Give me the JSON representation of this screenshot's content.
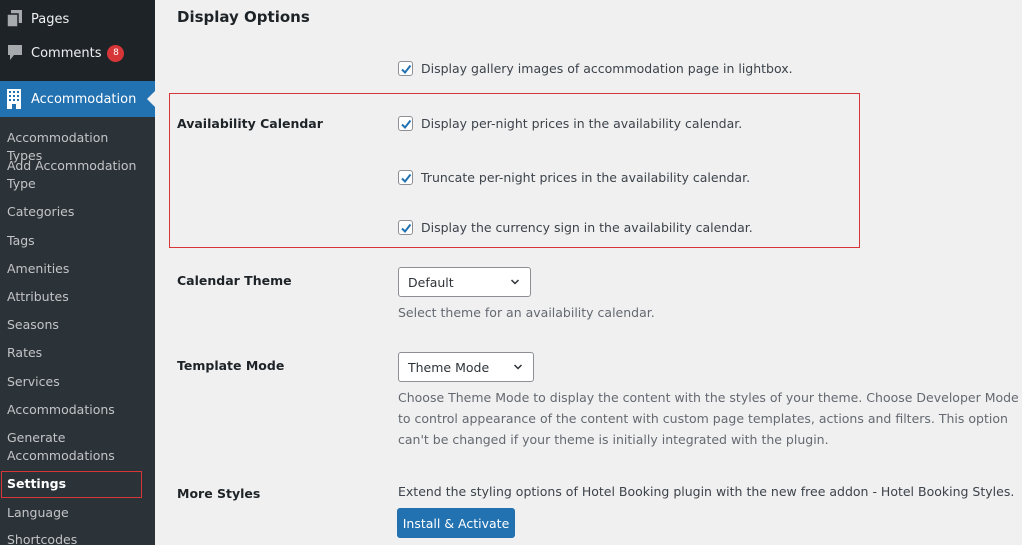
{
  "sidebar": {
    "top_items": [
      {
        "label": "Pages",
        "icon": "pages-icon"
      },
      {
        "label": "Comments",
        "icon": "comments-icon",
        "badge": "8"
      }
    ],
    "active": {
      "label": "Accommodation",
      "icon": "building-icon"
    },
    "submenu": [
      {
        "label": "Accommodation Types"
      },
      {
        "label": "Add Accommodation Type"
      },
      {
        "label": "Categories"
      },
      {
        "label": "Tags"
      },
      {
        "label": "Amenities"
      },
      {
        "label": "Attributes"
      },
      {
        "label": "Seasons"
      },
      {
        "label": "Rates"
      },
      {
        "label": "Services"
      },
      {
        "label": "Accommodations"
      },
      {
        "label": "Generate Accommodations"
      },
      {
        "label": "Settings",
        "current": true
      },
      {
        "label": "Language"
      },
      {
        "label": "Shortcodes"
      }
    ]
  },
  "main": {
    "section_title": "Display Options",
    "gallery_option": {
      "label": "Display gallery images of accommodation page in lightbox.",
      "checked": true
    },
    "availability_calendar": {
      "label": "Availability Calendar",
      "options": [
        {
          "label": "Display per-night prices in the availability calendar.",
          "checked": true
        },
        {
          "label": "Truncate per-night prices in the availability calendar.",
          "checked": true
        },
        {
          "label": "Display the currency sign in the availability calendar.",
          "checked": true
        }
      ]
    },
    "calendar_theme": {
      "label": "Calendar Theme",
      "selected": "Default",
      "description": "Select theme for an availability calendar."
    },
    "template_mode": {
      "label": "Template Mode",
      "selected": "Theme Mode",
      "description_lines": [
        "Choose Theme Mode to display the content with the styles of your theme. Choose Developer Mode",
        "to control appearance of the content with custom page templates, actions and filters. This option",
        "can't be changed if your theme is initially integrated with the plugin."
      ]
    },
    "more_styles": {
      "label": "More Styles",
      "description": "Extend the styling options of Hotel Booking plugin with the new free addon - Hotel Booking Styles.",
      "button_label": "Install & Activate"
    }
  },
  "colors": {
    "accent": "#2271b1",
    "sidebar_bg": "#1d2327",
    "submenu_bg": "#2c3338",
    "badge": "#d63638",
    "highlight_border": "#d63638"
  }
}
